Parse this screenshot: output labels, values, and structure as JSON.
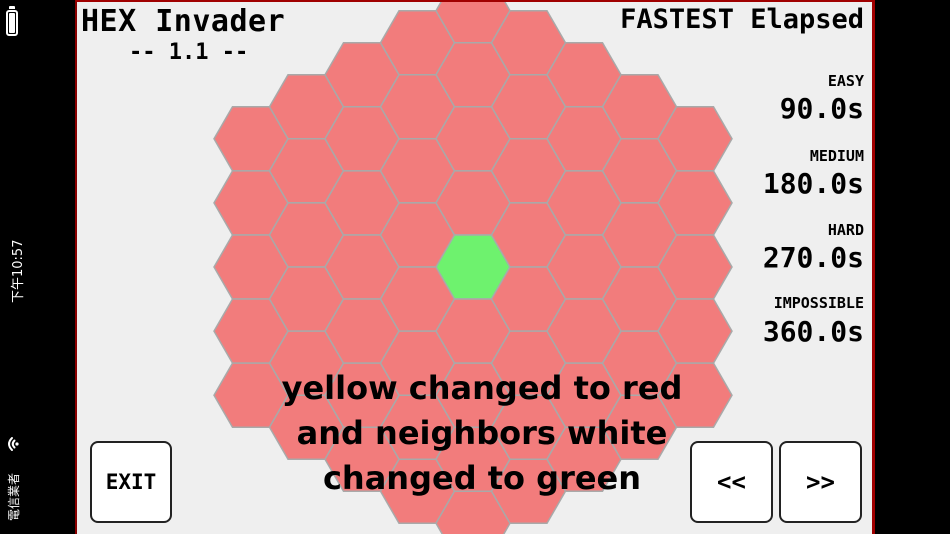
{
  "status_bar": {
    "time": "下午10:57",
    "carrier": "電信業者"
  },
  "game": {
    "title": "HEX Invader",
    "version": "-- 1.1 --",
    "records_title": "FASTEST Elapsed",
    "levels": [
      {
        "label": "EASY",
        "time": "90.0s"
      },
      {
        "label": "MEDIUM",
        "time": "180.0s"
      },
      {
        "label": "HARD",
        "time": "270.0s"
      },
      {
        "label": "IMPOSSIBLE",
        "time": "360.0s"
      }
    ],
    "exit_label": "EXIT",
    "prev_label": "<<",
    "next_label": ">>",
    "overlay_caption": [
      "yellow changed to red",
      "and neighbors white",
      "changed to green"
    ],
    "colors": {
      "red_cell": "#f27c7c",
      "green_cell": "#6ef26e",
      "cell_border": "#a9a9a9",
      "frame": "#a00000"
    },
    "board": {
      "highlighted_cell": "center",
      "highlight_color": "green",
      "other_cells_color": "red"
    }
  }
}
